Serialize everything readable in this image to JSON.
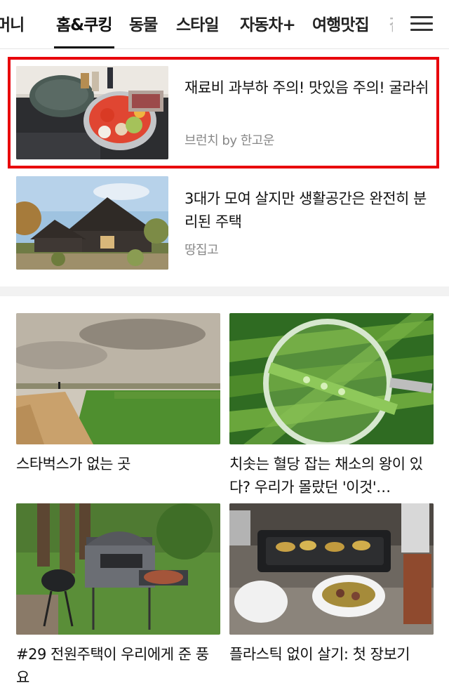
{
  "tabs": [
    {
      "label": "머니"
    },
    {
      "label": "홈&쿠킹"
    },
    {
      "label": "동물"
    },
    {
      "label": "스타일"
    },
    {
      "label": "자동차+"
    },
    {
      "label": "여행맛집"
    },
    {
      "label": "잡"
    }
  ],
  "active_tab": "홈&쿠킹",
  "menu_icon": "hamburger-menu-icon",
  "list": [
    {
      "title": "재료비 과부하 주의! 맛있음 주의! 굴라쉬",
      "source": "브런치 by 한고운",
      "highlighted": true
    },
    {
      "title": "3대가 모여 살지만 생활공간은 완전히 분리된 주택",
      "source": "땅집고",
      "highlighted": false
    }
  ],
  "grid": [
    {
      "title": "스타벅스가 없는 곳"
    },
    {
      "title": "치솟는 혈당 잡는 채소의 왕이 있다? 우리가 몰랐던 '이것'…"
    },
    {
      "title": "#29 전원주택이 우리에게 준 풍요"
    },
    {
      "title": "플라스틱 없이 살기: 첫 장보기"
    }
  ],
  "colors": {
    "highlight": "#e8000b",
    "text": "#111111",
    "muted": "#888888",
    "divider": "#f2f2f2"
  }
}
